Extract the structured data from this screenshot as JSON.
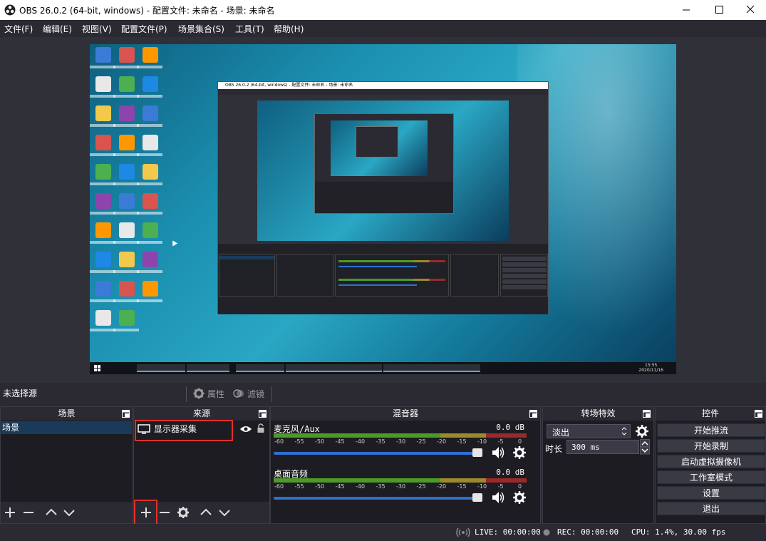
{
  "window": {
    "title": "OBS 26.0.2 (64-bit, windows) - 配置文件: 未命名 - 场景: 未命名",
    "controls": [
      "minimize-icon",
      "maximize-icon",
      "close-icon"
    ]
  },
  "menu": [
    {
      "label": "文件(F)"
    },
    {
      "label": "编辑(E)"
    },
    {
      "label": "视图(V)"
    },
    {
      "label": "配置文件(P)"
    },
    {
      "label": "场景集合(S)"
    },
    {
      "label": "工具(T)"
    },
    {
      "label": "帮助(H)"
    }
  ],
  "source_toolbar": {
    "no_selection": "未选择源",
    "properties": "属性",
    "filters": "滤镜"
  },
  "docks": {
    "scenes": {
      "title": "场景",
      "items": [
        "场景"
      ]
    },
    "sources": {
      "title": "来源",
      "items": [
        {
          "label": "显示器采集",
          "icon": "monitor-icon"
        }
      ]
    },
    "mixer": {
      "title": "混音器",
      "ticks": [
        "-60",
        "-55",
        "-50",
        "-45",
        "-40",
        "-35",
        "-30",
        "-25",
        "-20",
        "-15",
        "-10",
        "-5",
        "0"
      ],
      "channels": [
        {
          "name": "麦克风/Aux",
          "db": "0.0 dB",
          "level": 1.0
        },
        {
          "name": "桌面音频",
          "db": "0.0 dB",
          "level": 1.0
        }
      ]
    },
    "transitions": {
      "title": "转场特效",
      "selected": "淡出",
      "duration_label": "时长",
      "duration": "300 ms"
    },
    "controls": {
      "title": "控件",
      "buttons": [
        "开始推流",
        "开始录制",
        "启动虚拟摄像机",
        "工作室模式",
        "设置",
        "退出"
      ]
    }
  },
  "status": {
    "live": "LIVE: 00:00:00",
    "rec": "REC: 00:00:00",
    "cpu": "CPU: 1.4%, 30.00 fps"
  },
  "preview": {
    "clock_time": "15:55",
    "clock_date": "2020/11/16",
    "nested_title": "OBS 26.0.2 (64-bit, windows) - 配置文件: 未命名 - 场景: 未命名"
  },
  "colors": {
    "background": "#2b2a33",
    "dock_bg": "#1d1c22",
    "highlight_red": "#e0302a",
    "slider_blue": "#2e6fd2",
    "meter_green": "#4c9a2a",
    "meter_yellow": "#9a8a2a",
    "meter_red": "#9a2a2a"
  }
}
